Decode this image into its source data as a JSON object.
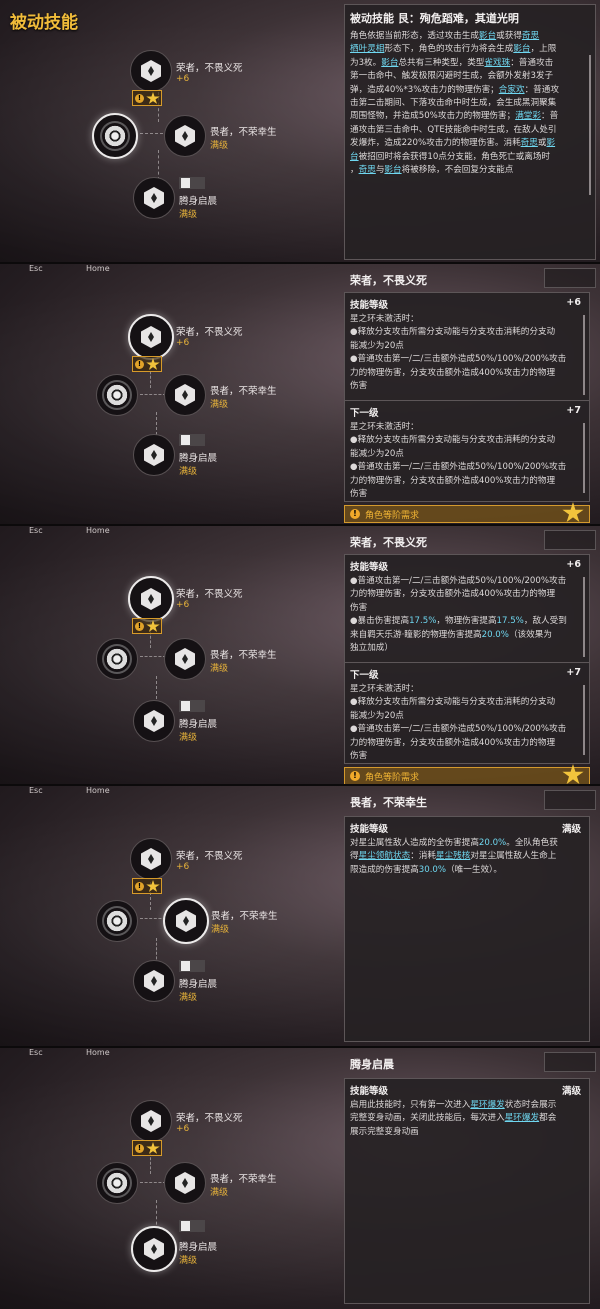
{
  "page_title": "被动技能",
  "nav": {
    "esc": "Esc",
    "home": "Home"
  },
  "skill_tree": {
    "node1": {
      "name": "荣者，不畏义死",
      "level": "+6"
    },
    "node2": {
      "name": "畏者，不荣幸生",
      "level": "满级"
    },
    "node3": {
      "name": "腾身启晨",
      "level": "满级"
    }
  },
  "panel1": {
    "title": "被动技能  艮：殉危蹈难，其道光明",
    "lines": [
      [
        {
          "t": "角色依据当前形态，透过攻击生成"
        },
        {
          "t": "影台",
          "c": "hl"
        },
        {
          "t": "或获得"
        },
        {
          "t": "奇思",
          "c": "hl"
        }
      ],
      [
        {
          "t": "栖叶灵相",
          "c": "hl"
        },
        {
          "t": "形态下，角色的攻击行为将会生成"
        },
        {
          "t": "影台",
          "c": "hl"
        },
        {
          "t": "，上限"
        }
      ],
      [
        {
          "t": "为3枚。"
        },
        {
          "t": "影台",
          "c": "hl"
        },
        {
          "t": "总共有三种类型，类型"
        },
        {
          "t": "雀戏珠",
          "c": "hl"
        },
        {
          "t": "：普通攻击"
        }
      ],
      [
        {
          "t": "第一击命中、触发极限闪避时生成，会额外发射3发子"
        }
      ],
      [
        {
          "t": "弹，造成40%*3%攻击力的物理伤害；"
        },
        {
          "t": "合家欢",
          "c": "hl"
        },
        {
          "t": "：普通攻"
        }
      ],
      [
        {
          "t": "击第二击期间、下落攻击命中时生成，会生成黑洞聚集"
        }
      ],
      [
        {
          "t": "周围怪物，并造成50%攻击力的物理伤害；"
        },
        {
          "t": "满堂彩",
          "c": "hl"
        },
        {
          "t": "：普"
        }
      ],
      [
        {
          "t": "通攻击第三击命中、QTE技能命中时生成，在敌人处引"
        }
      ],
      [
        {
          "t": "发爆炸，造成220%攻击力的物理伤害。消耗"
        },
        {
          "t": "奇思",
          "c": "hl"
        },
        {
          "t": "或"
        },
        {
          "t": "影",
          "c": "hl"
        }
      ],
      [
        {
          "t": "台",
          "c": "hl"
        },
        {
          "t": "被招回时将会获得10点分支能，角色死亡或离场时"
        }
      ],
      [
        {
          "t": "，"
        },
        {
          "t": "奇思",
          "c": "hl"
        },
        {
          "t": "与"
        },
        {
          "t": "影台",
          "c": "hl"
        },
        {
          "t": "将被移除，不会回复分支能点"
        }
      ]
    ]
  },
  "panel2": {
    "title": "荣者，不畏义死",
    "cur_label": "技能等级",
    "cur_level": "+6",
    "cur_lines": [
      [
        {
          "t": "星之环未激活时："
        }
      ],
      [
        {
          "t": "●释放分支攻击所需分支动能与分支攻击消耗的分支动"
        }
      ],
      [
        {
          "t": "能减少为20点"
        }
      ],
      [
        {
          "t": "●普通攻击第一/二/三击额外造成50%/100%/200%攻击"
        }
      ],
      [
        {
          "t": "力的物理伤害，分支攻击额外造成400%攻击力的物理"
        }
      ],
      [
        {
          "t": "伤害"
        }
      ]
    ],
    "next_label": "下一级",
    "next_level": "+7",
    "next_lines": [
      [
        {
          "t": "星之环未激活时："
        }
      ],
      [
        {
          "t": "●释放分支攻击所需分支动能与分支攻击消耗的分支动"
        }
      ],
      [
        {
          "t": "能减少为20点"
        }
      ],
      [
        {
          "t": "●普通攻击第一/二/三击额外造成50%/100%/200%攻击"
        }
      ],
      [
        {
          "t": "力的物理伤害，分支攻击额外造成400%攻击力的物理"
        }
      ],
      [
        {
          "t": "伤害"
        }
      ]
    ],
    "req": "角色等阶需求"
  },
  "panel3": {
    "title": "荣者，不畏义死",
    "cur_label": "技能等级",
    "cur_level": "+6",
    "cur_lines": [
      [
        {
          "t": "●普通攻击第一/二/三击额外造成50%/100%/200%攻击"
        }
      ],
      [
        {
          "t": "力的物理伤害，分支攻击额外造成400%攻击力的物理"
        }
      ],
      [
        {
          "t": "伤害"
        }
      ],
      [
        {
          "t": "●暴击伤害提高"
        },
        {
          "t": "17.5%",
          "c": "num"
        },
        {
          "t": "，物理伤害提高"
        },
        {
          "t": "17.5%",
          "c": "num"
        },
        {
          "t": "，敌人受到"
        }
      ],
      [
        {
          "t": "来自羁天乐游·瞳影的物理伤害提高"
        },
        {
          "t": "20.0%",
          "c": "num"
        },
        {
          "t": "（该效果为"
        }
      ],
      [
        {
          "t": "独立加成）"
        }
      ]
    ],
    "next_label": "下一级",
    "next_level": "+7",
    "next_lines": [
      [
        {
          "t": "星之环未激活时："
        }
      ],
      [
        {
          "t": "●释放分支攻击所需分支动能与分支攻击消耗的分支动"
        }
      ],
      [
        {
          "t": "能减少为20点"
        }
      ],
      [
        {
          "t": "●普通攻击第一/二/三击额外造成50%/100%/200%攻击"
        }
      ],
      [
        {
          "t": "力的物理伤害，分支攻击额外造成400%攻击力的物理"
        }
      ],
      [
        {
          "t": "伤害"
        }
      ]
    ],
    "req": "角色等阶需求"
  },
  "panel4": {
    "title": "畏者，不荣幸生",
    "cur_label": "技能等级",
    "cur_level": "满级",
    "cur_lines": [
      [
        {
          "t": "对星尘属性敌人造成的全伤害提高"
        },
        {
          "t": "20.0%",
          "c": "num"
        },
        {
          "t": "。全队角色获"
        }
      ],
      [
        {
          "t": "得"
        },
        {
          "t": "星尘领航状态",
          "c": "hl"
        },
        {
          "t": "：消耗"
        },
        {
          "t": "星尘残核",
          "c": "hl"
        },
        {
          "t": "对星尘属性敌人生命上"
        }
      ],
      [
        {
          "t": "限造成的伤害提高"
        },
        {
          "t": "30.0%",
          "c": "num"
        },
        {
          "t": "（唯一生效）。"
        }
      ]
    ]
  },
  "panel5": {
    "title": "腾身启晨",
    "cur_label": "技能等级",
    "cur_level": "满级",
    "cur_lines": [
      [
        {
          "t": "启用此技能时，只有第一次进入"
        },
        {
          "t": "星环爆发",
          "c": "hl"
        },
        {
          "t": "状态时会展示"
        }
      ],
      [
        {
          "t": "完整变身动画，关闭此技能后，每次进入"
        },
        {
          "t": "星环爆发",
          "c": "hl"
        },
        {
          "t": "都会"
        }
      ],
      [
        {
          "t": "展示完整变身动画"
        }
      ]
    ]
  }
}
